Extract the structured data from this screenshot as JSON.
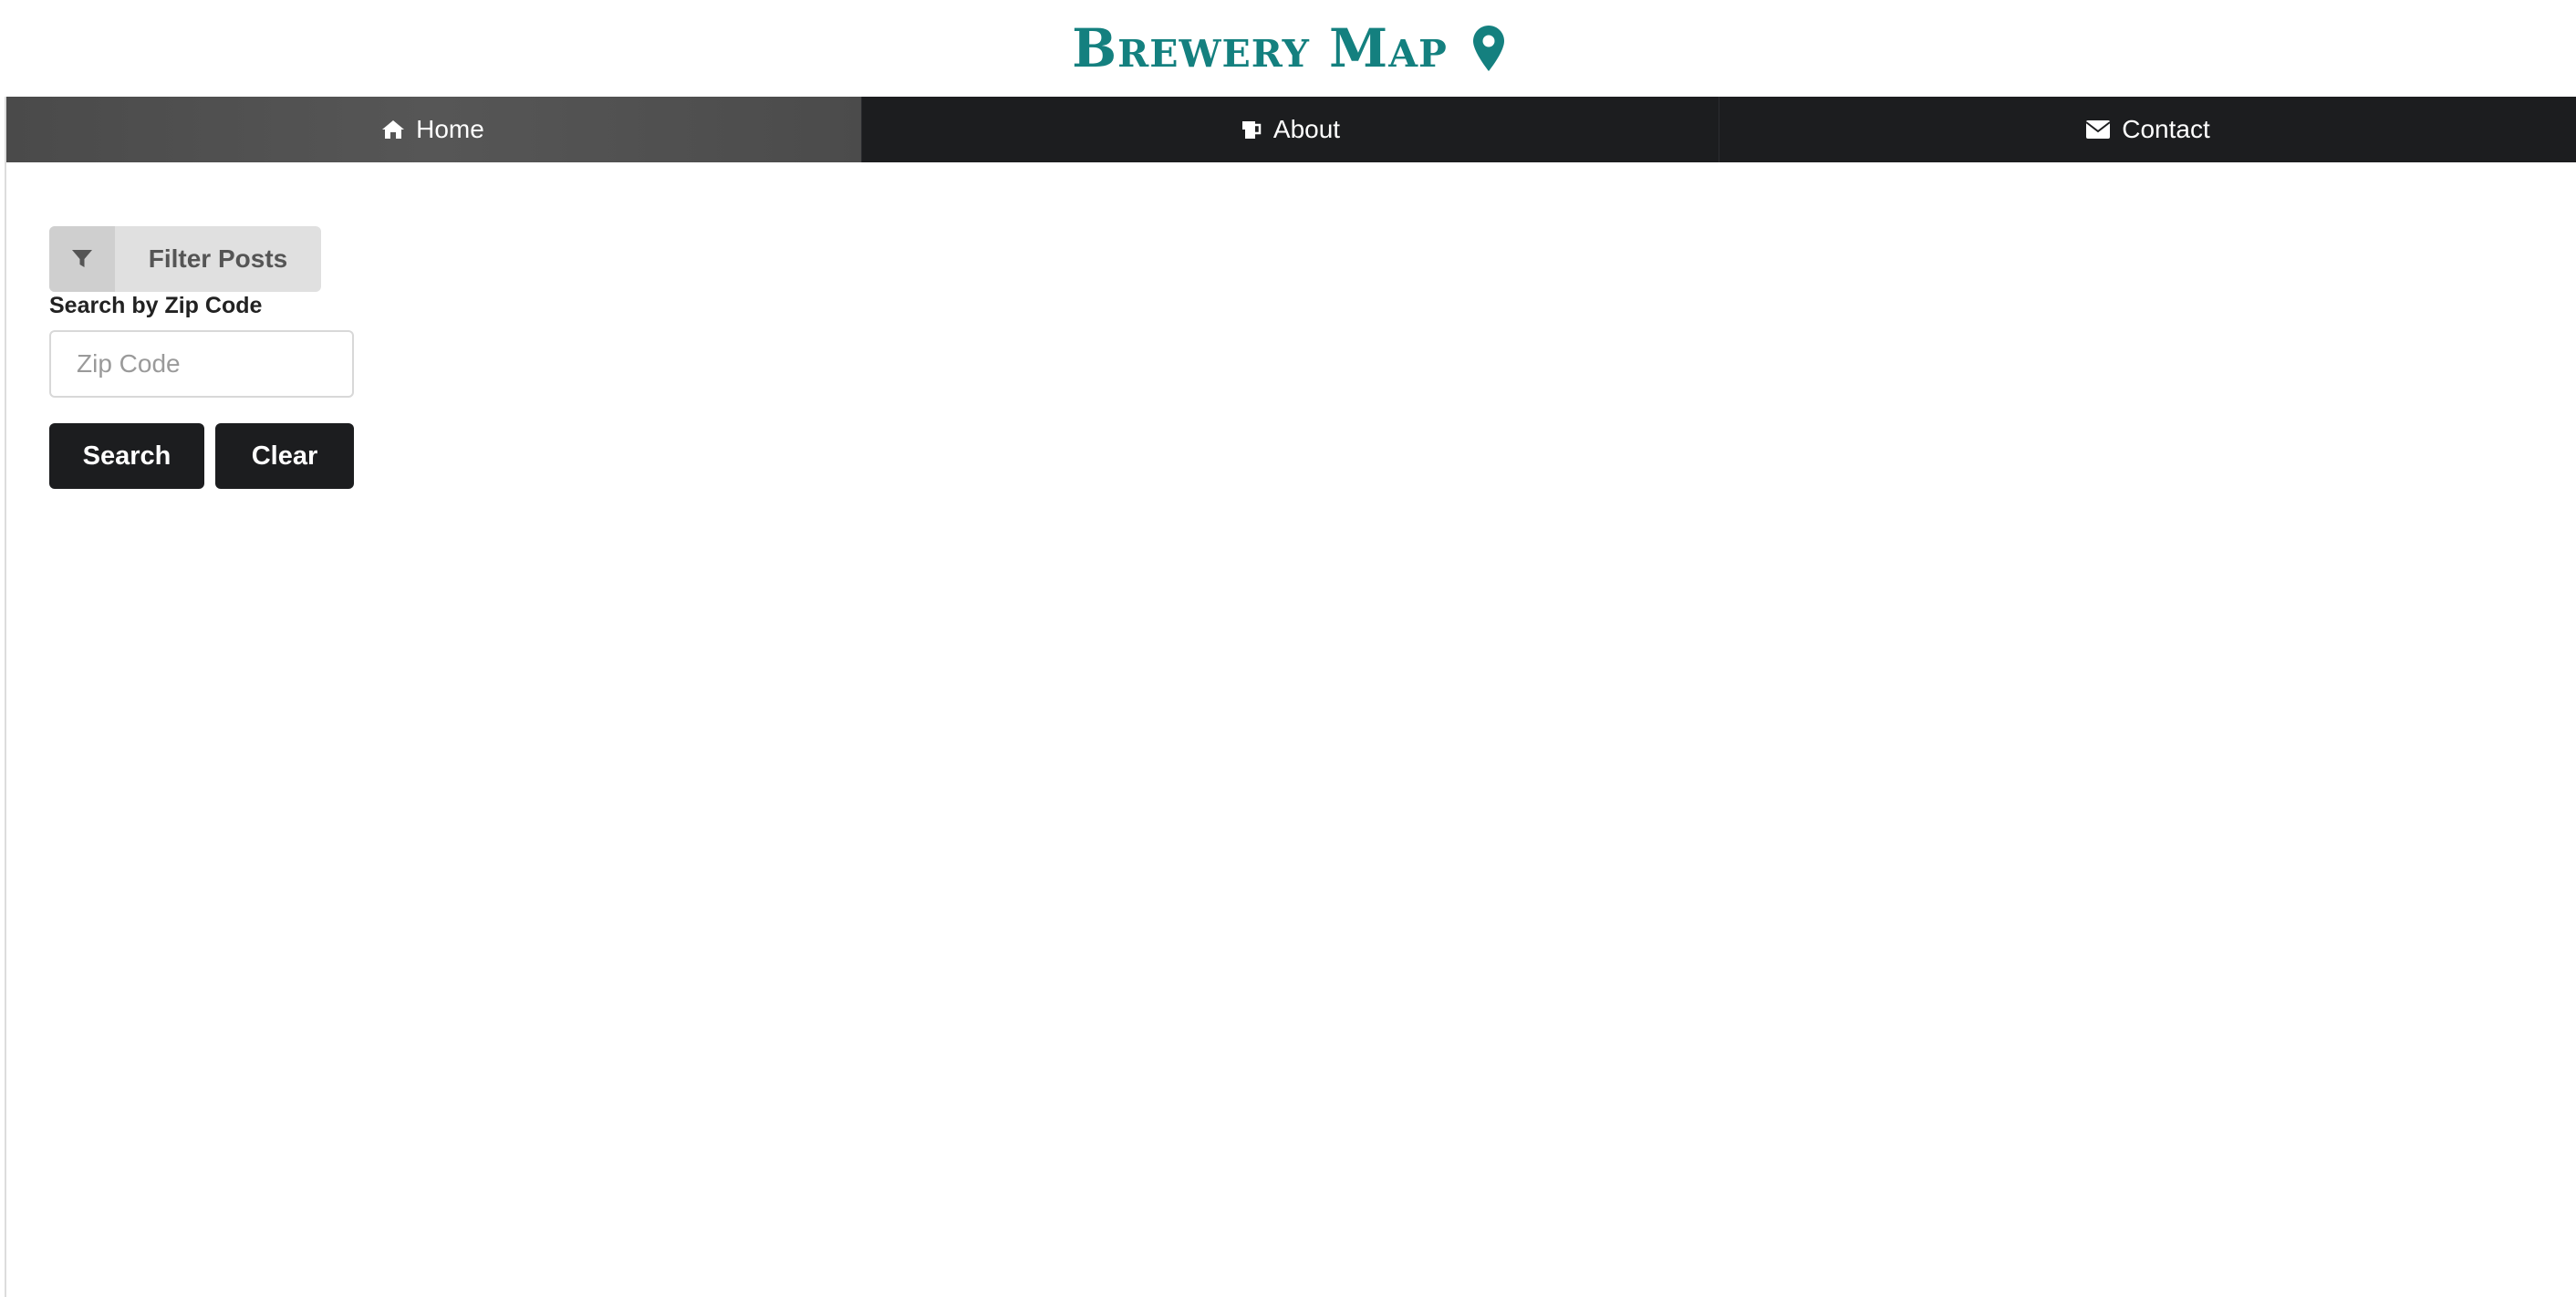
{
  "header": {
    "title": "Brewery Map",
    "icon": "map-marker-icon",
    "accent_color": "#14807f"
  },
  "nav": {
    "items": [
      {
        "label": "Home",
        "icon": "home-icon",
        "active": true
      },
      {
        "label": "About",
        "icon": "beer-mug-icon",
        "active": false
      },
      {
        "label": "Contact",
        "icon": "envelope-icon",
        "active": false
      }
    ],
    "background": "#1c1d1f"
  },
  "filter": {
    "toggle_label": "Filter Posts",
    "toggle_icon": "filter-icon",
    "zip_label": "Search by Zip Code",
    "zip_placeholder": "Zip Code",
    "zip_value": "",
    "search_label": "Search",
    "clear_label": "Clear"
  }
}
